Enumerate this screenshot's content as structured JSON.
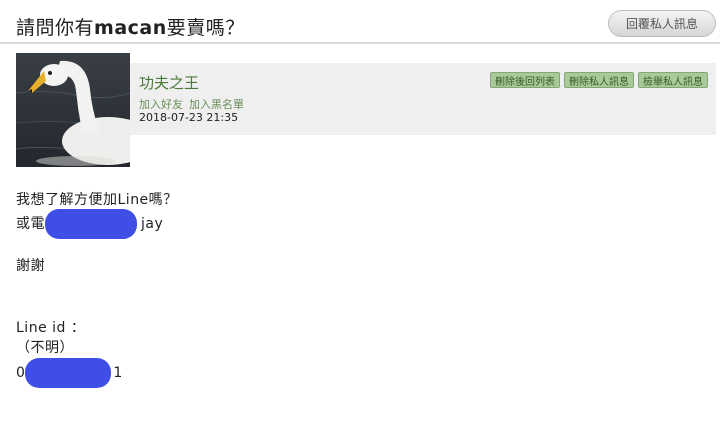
{
  "header": {
    "title_before": "請問你有",
    "title_bold": "macan",
    "title_after": "要賣嗎？",
    "reply_button": "回覆私人訊息"
  },
  "sender": {
    "name": "功夫之王",
    "add_friend": "加入好友",
    "add_blacklist": "加入黑名單",
    "date": "2018-07-23 21:35",
    "actions": [
      "刪除後回列表",
      "刪除私人訊息",
      "檢舉私人訊息"
    ]
  },
  "message": {
    "line1": "我想了解方便加Line嗎？",
    "line2_prefix": "或電",
    "line2_suffix": "jay",
    "line3": "謝謝",
    "line4": "Line id ：",
    "line5": "（不明）",
    "line6_prefix": "0",
    "line6_suffix": "1"
  },
  "colors": {
    "redaction": "#3f4fe6",
    "accent_green": "#4a7a3a"
  }
}
